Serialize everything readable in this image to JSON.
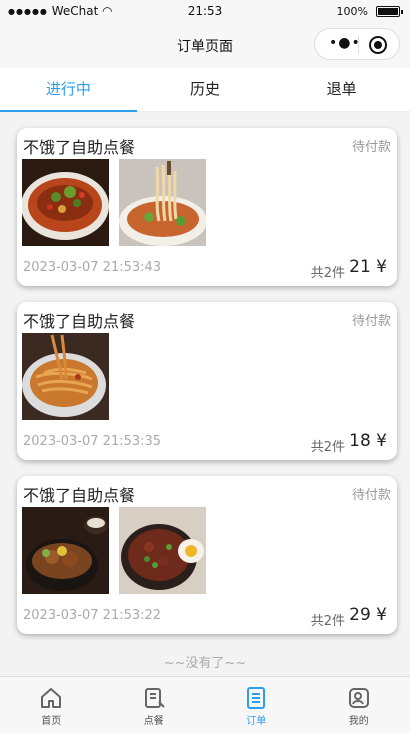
{
  "status_bar": {
    "carrier": "WeChat",
    "time": "21:53",
    "battery": "100%"
  },
  "navbar": {
    "title": "订单页面"
  },
  "tabs": [
    {
      "label": "进行中",
      "active": true
    },
    {
      "label": "历史",
      "active": false
    },
    {
      "label": "退单",
      "active": false
    }
  ],
  "orders": [
    {
      "shop": "不饿了自助点餐",
      "status": "待付款",
      "time": "2023-03-07 21:53:43",
      "count": "共2件",
      "price": "21 ¥"
    },
    {
      "shop": "不饿了自助点餐",
      "status": "待付款",
      "time": "2023-03-07 21:53:35",
      "count": "共2件",
      "price": "18 ¥"
    },
    {
      "shop": "不饿了自助点餐",
      "status": "待付款",
      "time": "2023-03-07 21:53:22",
      "count": "共2件",
      "price": "29 ¥"
    }
  ],
  "end_text": "~~没有了~~",
  "tabbar": [
    {
      "label": "首页",
      "icon": "home-icon",
      "active": false
    },
    {
      "label": "点餐",
      "icon": "menu-icon",
      "active": false
    },
    {
      "label": "订单",
      "icon": "order-icon",
      "active": true
    },
    {
      "label": "我的",
      "icon": "profile-icon",
      "active": false
    }
  ],
  "colors": {
    "accent": "#2a9ff0",
    "background": "#f3f3f3"
  }
}
